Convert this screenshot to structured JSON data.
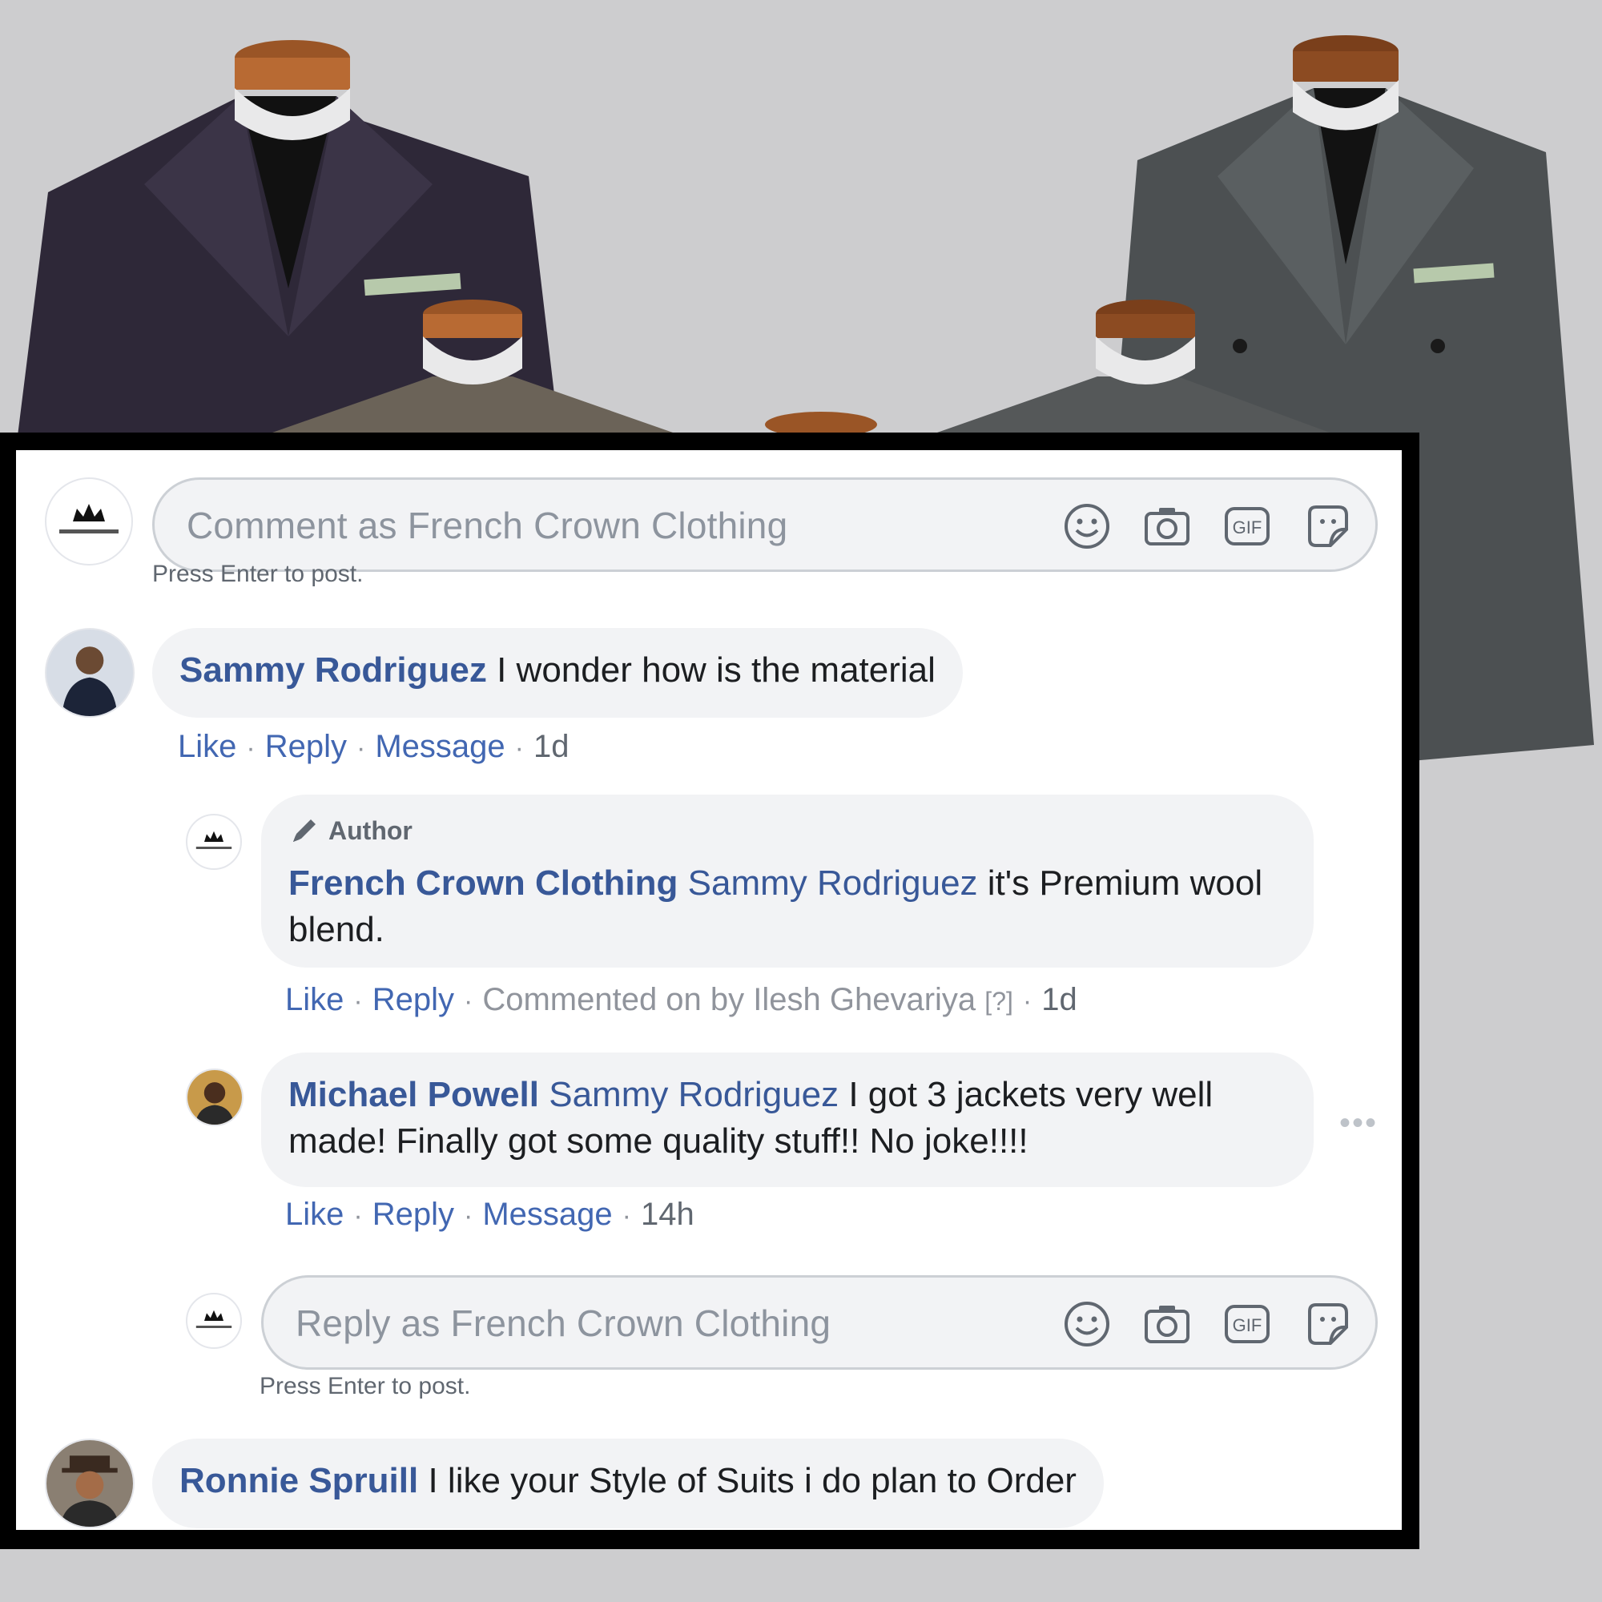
{
  "composer": {
    "placeholder": "Comment as French Crown Clothing",
    "hint": "Press Enter to post."
  },
  "reply_composer": {
    "placeholder": "Reply as French Crown Clothing",
    "hint": "Press Enter to post."
  },
  "icons": {
    "emoji": "smiley-icon",
    "camera": "camera-icon",
    "gif": "gif-icon",
    "sticker": "sticker-icon",
    "gif_label": "GIF"
  },
  "labels": {
    "like": "Like",
    "reply": "Reply",
    "message": "Message",
    "dot": "·",
    "more": "•••"
  },
  "comments": [
    {
      "author": "Sammy Rodriguez",
      "text": "I wonder how is the material",
      "time": "1d"
    },
    {
      "badge": "Author",
      "author": "French Crown Clothing",
      "mention": "Sammy Rodriguez",
      "text": "it's Premium wool blend.",
      "commented_by": "Commented on by Ilesh Ghevariya",
      "help": "[?]",
      "time": "1d"
    },
    {
      "author": "Michael Powell",
      "mention": "Sammy Rodriguez",
      "text": "I got 3 jackets very well made! Finally got some quality stuff!! No joke!!!!",
      "time": "14h"
    },
    {
      "author": "Ronnie Spruill",
      "text": "I like your Style of Suits i do plan to Order"
    }
  ],
  "brand": {
    "label_text": "FRENCH CROWN"
  },
  "colors": {
    "link": "#385898",
    "action_link": "#4267b2",
    "bubble": "#f2f3f5",
    "muted": "#606770",
    "background": "#cdcdcf"
  }
}
